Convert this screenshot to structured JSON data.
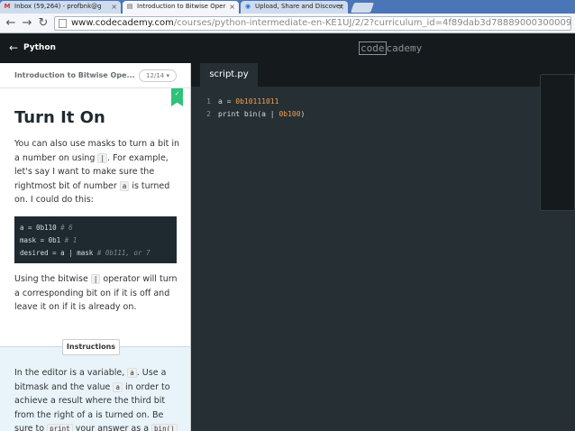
{
  "browser": {
    "tabs": [
      {
        "icon": "M",
        "icon_color": "#d93025",
        "title": "Inbox (59,264) - profbnk@g",
        "active": false
      },
      {
        "icon": "▤",
        "icon_color": "#555555",
        "title": "Introduction to Bitwise Oper",
        "active": true
      },
      {
        "icon": "◉",
        "icon_color": "#1a73e8",
        "title": "Upload, Share and Discover",
        "active": false
      }
    ],
    "url_host": "www.codecademy.com",
    "url_path": "/courses/python-intermediate-en-KE1UJ/2/2?curriculum_id=4f89dab3d788890003000096"
  },
  "header": {
    "back": "←",
    "course": "Python",
    "logo_boxed": "code",
    "logo_rest": "cademy"
  },
  "lesson": {
    "title": "Introduction to Bitwise Ope...",
    "progress": "12/14",
    "heading": "Turn It On",
    "p1": {
      "t1": "You can also use masks to turn a bit in a number on using ",
      "c1": "|",
      "t2": ". For example, let's say I want to make sure the rightmost bit of number ",
      "c2": "a",
      "t3": " is turned on. I could do this:"
    },
    "code": {
      "l1": "a = 0b110 ",
      "l1c": "# 6",
      "l2": "mask = 0b1 ",
      "l2c": "# 1",
      "l3": "desired =  a | mask ",
      "l3c": "# 0b111, or 7"
    },
    "p2": {
      "t1": "Using the bitwise ",
      "c1": "|",
      "t2": " operator will turn a corresponding bit on if it is off and leave it on if it is already on."
    },
    "instructions_label": "Instructions",
    "p3": {
      "t1": "In the editor is a variable, ",
      "c1": "a",
      "t2": ". Use a bitmask and the value ",
      "c2": "a",
      "t3": " in order to achieve a result where the third bit from the right of a is turned on. Be sure to ",
      "c3": "print",
      "t4": " your answer as a ",
      "c4": "bin()"
    }
  },
  "editor": {
    "file_tab": "script.py",
    "line_numbers": [
      "1",
      "2"
    ],
    "line1_a": "a = ",
    "line1_num": "0b10111011",
    "line2_a": "print bin(a | ",
    "line2_num": "0b100",
    "line2_b": ")"
  }
}
